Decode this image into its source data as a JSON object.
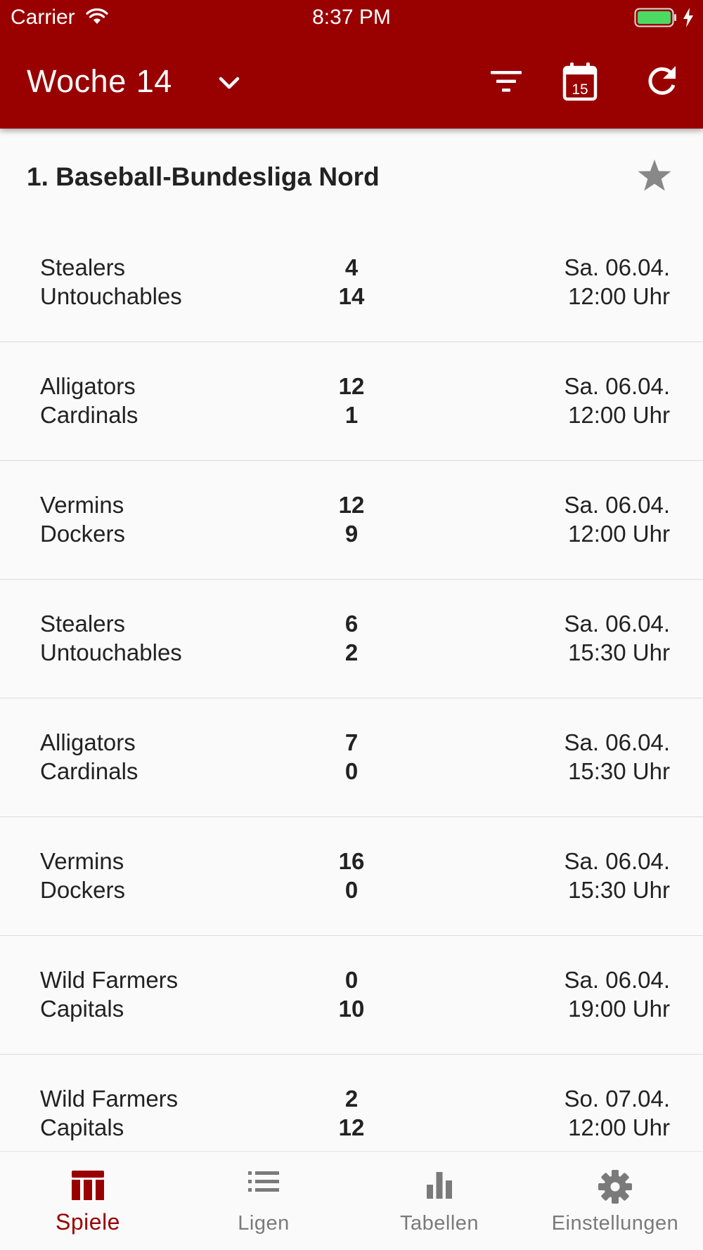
{
  "status_bar": {
    "carrier": "Carrier",
    "time": "8:37 PM"
  },
  "app_bar": {
    "title_prefix": "Woche",
    "title_number": "14",
    "calendar_day": "15"
  },
  "league": {
    "title": "1. Baseball-Bundesliga Nord"
  },
  "games": [
    {
      "home": "Stealers",
      "away": "Untouchables",
      "home_score": "4",
      "away_score": "14",
      "date": "Sa. 06.04.",
      "time": "12:00 Uhr"
    },
    {
      "home": "Alligators",
      "away": "Cardinals",
      "home_score": "12",
      "away_score": "1",
      "date": "Sa. 06.04.",
      "time": "12:00 Uhr"
    },
    {
      "home": "Vermins",
      "away": "Dockers",
      "home_score": "12",
      "away_score": "9",
      "date": "Sa. 06.04.",
      "time": "12:00 Uhr"
    },
    {
      "home": "Stealers",
      "away": "Untouchables",
      "home_score": "6",
      "away_score": "2",
      "date": "Sa. 06.04.",
      "time": "15:30 Uhr"
    },
    {
      "home": "Alligators",
      "away": "Cardinals",
      "home_score": "7",
      "away_score": "0",
      "date": "Sa. 06.04.",
      "time": "15:30 Uhr"
    },
    {
      "home": "Vermins",
      "away": "Dockers",
      "home_score": "16",
      "away_score": "0",
      "date": "Sa. 06.04.",
      "time": "15:30 Uhr"
    },
    {
      "home": "Wild Farmers",
      "away": "Capitals",
      "home_score": "0",
      "away_score": "10",
      "date": "Sa. 06.04.",
      "time": "19:00 Uhr"
    },
    {
      "home": "Wild Farmers",
      "away": "Capitals",
      "home_score": "2",
      "away_score": "12",
      "date": "So. 07.04.",
      "time": "12:00 Uhr"
    }
  ],
  "bottom_nav": [
    {
      "label": "Spiele",
      "icon": "scoreboard-icon",
      "active": true
    },
    {
      "label": "Ligen",
      "icon": "list-icon",
      "active": false
    },
    {
      "label": "Tabellen",
      "icon": "bar-chart-icon",
      "active": false
    },
    {
      "label": "Einstellungen",
      "icon": "gear-icon",
      "active": false
    }
  ],
  "colors": {
    "primary": "#990000",
    "background": "#fafafa",
    "inactive": "#7a7a7a"
  }
}
